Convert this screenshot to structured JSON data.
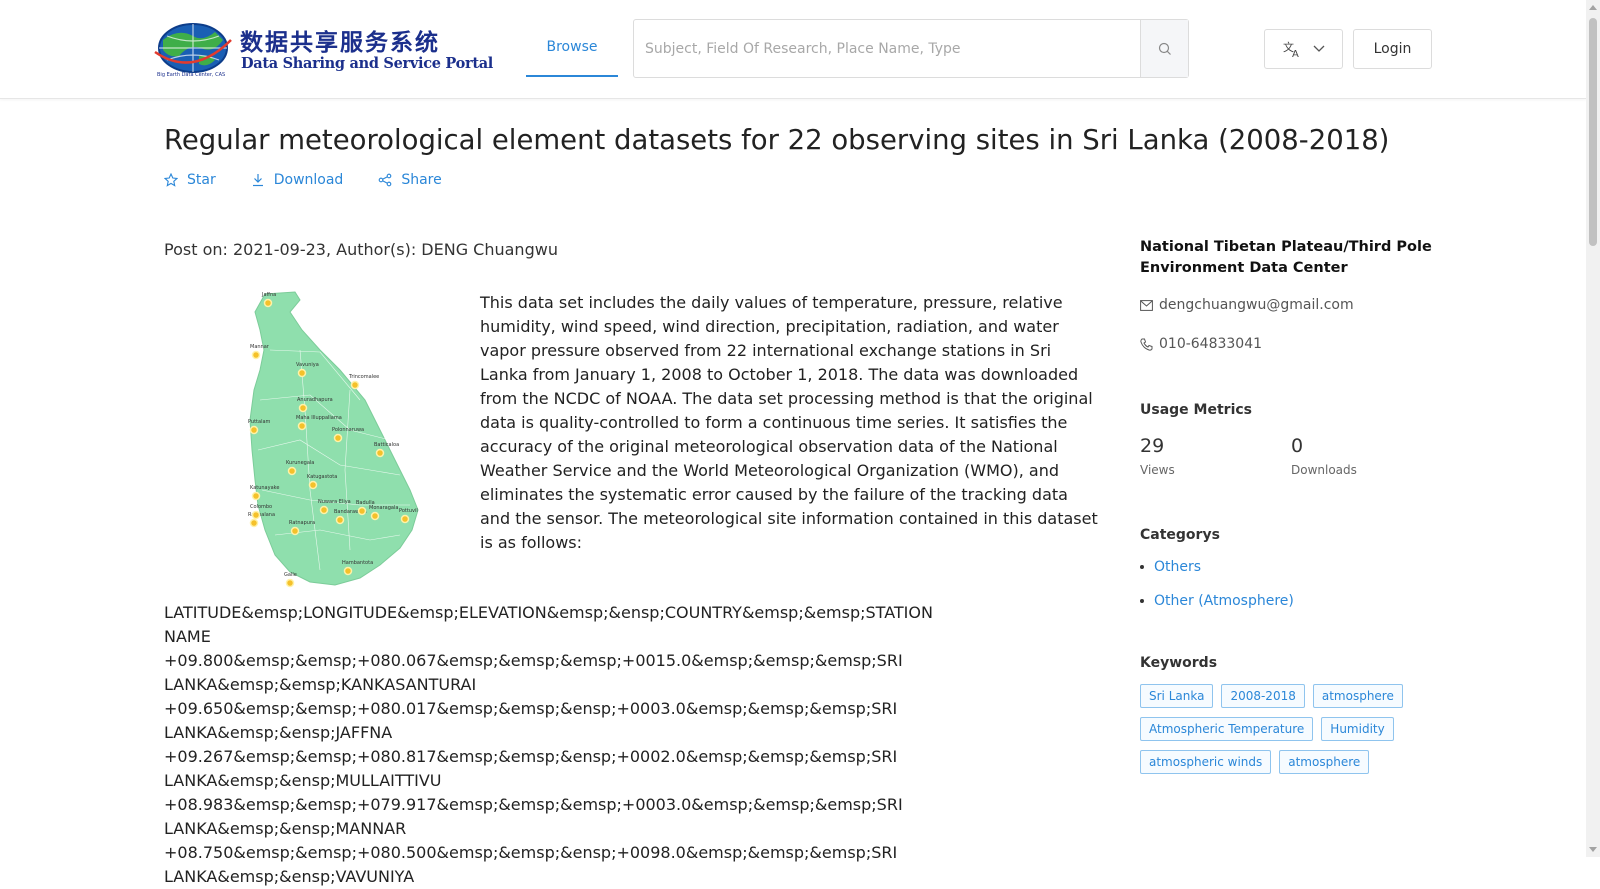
{
  "header": {
    "logo_cn": "数据共享服务系统",
    "logo_en": "Data Sharing and Service Portal",
    "logo_tiny": "Big Earth Data Center, CAS",
    "nav_browse": "Browse",
    "search_placeholder": "Subject, Field Of Research, Place Name, Type",
    "login": "Login"
  },
  "dataset": {
    "title": "Regular meteorological element datasets for 22 observing sites in Sri Lanka (2008-2018)",
    "actions": {
      "star": "Star",
      "download": "Download",
      "share": "Share"
    },
    "post_meta": "Post on: 2021-09-23, Author(s): DENG Chuangwu",
    "description": "This data set includes the daily values of temperature, pressure, relative humidity, wind speed, wind direction, precipitation, radiation, and water vapor pressure observed from 22 international exchange stations in Sri Lanka from January 1, 2008 to October 1, 2018. The data was downloaded from the NCDC of NOAA. The data set processing method is that the original data is quality-controlled to form a continuous time series. It satisfies the accuracy of the original meteorological observation data of the National Weather Service and the World Meteorological Organization (WMO), and eliminates the systematic error caused by the failure of the tracking data and the sensor. The meteorological site information contained in this dataset is as follows:",
    "stations": [
      "LATITUDE&emsp;LONGITUDE&emsp;ELEVATION&emsp;&ensp;COUNTRY&emsp;&emsp;STATION NAME",
      "+09.800&emsp;&emsp;+080.067&emsp;&emsp;&emsp;+0015.0&emsp;&emsp;&emsp;SRI LANKA&emsp;&emsp;KANKASANTURAI",
      "+09.650&emsp;&emsp;+080.017&emsp;&emsp;&ensp;+0003.0&emsp;&emsp;&emsp;SRI LANKA&emsp;&ensp;JAFFNA",
      "+09.267&emsp;&emsp;+080.817&emsp;&emsp;&ensp;+0002.0&emsp;&emsp;&emsp;SRI LANKA&emsp;&ensp;MULLAITTIVU",
      "+08.983&emsp;&emsp;+079.917&emsp;&emsp;&emsp;+0003.0&emsp;&emsp;&emsp;SRI LANKA&emsp;&ensp;MANNAR",
      "+08.750&emsp;&emsp;+080.500&emsp;&emsp;&ensp;+0098.0&emsp;&emsp;&emsp;SRI LANKA&emsp;&ensp;VAVUNIYA"
    ],
    "map_labels": [
      "Jaffna",
      "Mannar",
      "Vavuniya",
      "Trincomalee",
      "Anuradhapura",
      "Maha Illuppallama",
      "Puttalam",
      "Polonnaruwa",
      "Batticaloa",
      "Kurunegala",
      "Katugastota",
      "Katunayake",
      "Nuwara Eliya",
      "Badulla",
      "Colombo",
      "Ratmalana",
      "Bandarawela",
      "Monaragala",
      "Pottuvil",
      "Ratnapura",
      "Hambantota",
      "Galle"
    ]
  },
  "sidebar": {
    "org": "National Tibetan Plateau/Third Pole Environment Data Center",
    "email": "dengchuangwu@gmail.com",
    "phone": "010-64833041",
    "usage_heading": "Usage Metrics",
    "views_value": "29",
    "views_label": "Views",
    "downloads_value": "0",
    "downloads_label": "Downloads",
    "categories_heading": "Categorys",
    "categories": [
      "Others",
      "Other (Atmosphere)"
    ],
    "keywords_heading": "Keywords",
    "keywords": [
      "Sri Lanka",
      "2008-2018",
      "atmosphere",
      "Atmospheric Temperature",
      "Humidity",
      "atmospheric winds",
      "atmosphere"
    ]
  },
  "colors": {
    "accent": "#2b87d8",
    "map_land": "#8fdfad",
    "station_dot": "#f5c12a"
  }
}
